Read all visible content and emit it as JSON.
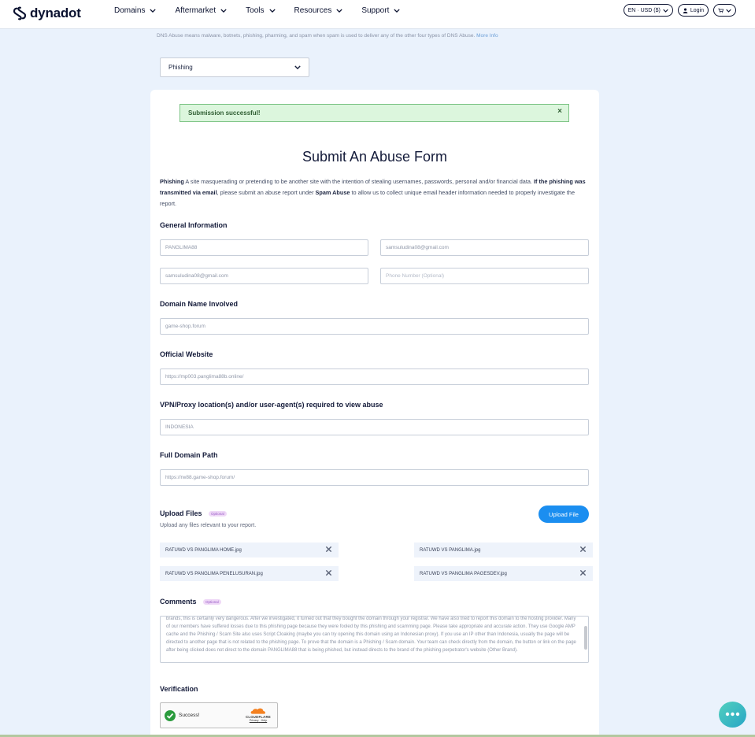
{
  "nav": {
    "brand": "dynadot",
    "menu": [
      "Domains",
      "Aftermarket",
      "Tools",
      "Resources",
      "Support"
    ],
    "currency": "EN · USD ($)",
    "login": "Login"
  },
  "top": {
    "dns_note": "DNS Abuse means malware, botnets, phishing, pharming, and spam when spam is used to deliver any of the other four types of DNS Abuse.",
    "more_info": "More Info",
    "abuse_type": "Phishing"
  },
  "alert": {
    "message": "Submission successful!",
    "close": "×"
  },
  "form": {
    "title": "Submit An Abuse Form",
    "desc": {
      "term": "Phishing",
      "definition": " A site masquerading or pretending to be another site with the intention of stealing usernames, passwords, personal and/or financial data. ",
      "cond": "If the phishing was transmitted via email",
      "mid": ", please submit an abuse report under ",
      "spam": "Spam Abuse",
      "tail": " to allow us to collect unique email header information needed to properly investigate the report."
    },
    "general_info": {
      "label": "General Information",
      "name": "PANGLIMA88",
      "email": "samsuludina08@gmail.com",
      "confirm_email": "samsuludina08@gmail.com",
      "phone_placeholder": "Phone Number (Optional)"
    },
    "domain": {
      "label": "Domain Name Involved",
      "value": "game-shop.forum"
    },
    "website": {
      "label": "Official Website",
      "value": "https://mp003.panglima88b.online/"
    },
    "vpn": {
      "label": "VPN/Proxy location(s) and/or user-agent(s) required to view abuse",
      "value": "INDONESIA"
    },
    "path": {
      "label": "Full Domain Path",
      "value": "https://rw88.game-shop.forum/"
    },
    "upload": {
      "label": "Upload Files",
      "optional": "Optional",
      "sub": "Upload any files relevant to your report.",
      "button": "Upload File",
      "files": [
        "RATUWD VS PANGLIMA HOME.jpg",
        "RATUWD VS PANGLIMA.jpg",
        "RATUWD VS PANGLIMA PENELUSURAN.jpg",
        "RATUWD VS PANGLIMA PAGESDEV.jpg"
      ]
    },
    "comments": {
      "label": "Comments",
      "optional": "Optional",
      "text": "brands, this is certainly very dangerous. After we investigated, it turned out that they bought the domain through your registrar. We have also tried to report this domain to the hosting provider. Many of our members have suffered losses due to this phishing page because they were fooled by this phishing and scamming page. Please take appropriate and accurate action. They use Google AMP cache and the Phishing / Scam Site also uses Script Cloaking (maybe you can try opening this domain using an Indonesian proxy). If you use an IP other than Indonesia, usually the page will be directed to another page that is not related to the phishing page. To prove that the domain is a Phishing / Scam domain. Your team can check directly from the domain, the button or link on the page after being clicked does not direct to the domain PANGLIMA88 that is being phished, but instead directs to the brand of the phishing perpetrator's website (Other Brand)."
    },
    "verification": {
      "label": "Verification",
      "status": "Success!",
      "provider": "CLOUDFLARE",
      "privacy": "Privacy",
      "sep": " · ",
      "help": "Help"
    }
  },
  "colors": {
    "accent": "#1b8ef0",
    "success_bg": "#dcf6dd",
    "page_bg": "#eaf2fc"
  }
}
